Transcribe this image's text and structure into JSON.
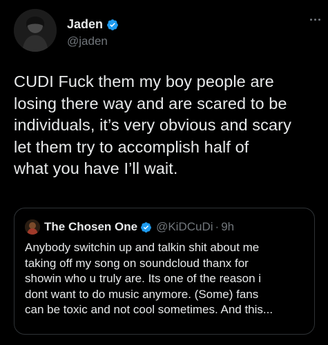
{
  "tweet": {
    "author_name": "Jaden",
    "author_handle": "@jaden",
    "verified": true,
    "text_lines": [
      "CUDI Fuck them my boy people are",
      "losing there way and are scared to be",
      "individuals, it’s very obvious and scary",
      "let them try to accomplish half of",
      "what you have I’ll wait."
    ]
  },
  "quoted_tweet": {
    "author_name": "The Chosen One",
    "author_handle": "@KiDCuDi",
    "separator": "·",
    "time": "9h",
    "verified": true,
    "text_lines": [
      "Anybody switchin up and talkin shit about me",
      "taking off my song on soundcloud thanx for",
      "showin who u truly are.  Its one of the reason i",
      "dont want to do music anymore.  (Some) fans",
      "can be toxic and not cool sometimes.  And this..."
    ]
  },
  "icons": {
    "verified": "verified-badge-icon",
    "more": "more-options-icon"
  },
  "colors": {
    "background": "#000000",
    "text_primary": "#e7e9ea",
    "text_secondary": "#71767b",
    "verified_blue": "#1d9bf0",
    "border": "#2f3336"
  }
}
